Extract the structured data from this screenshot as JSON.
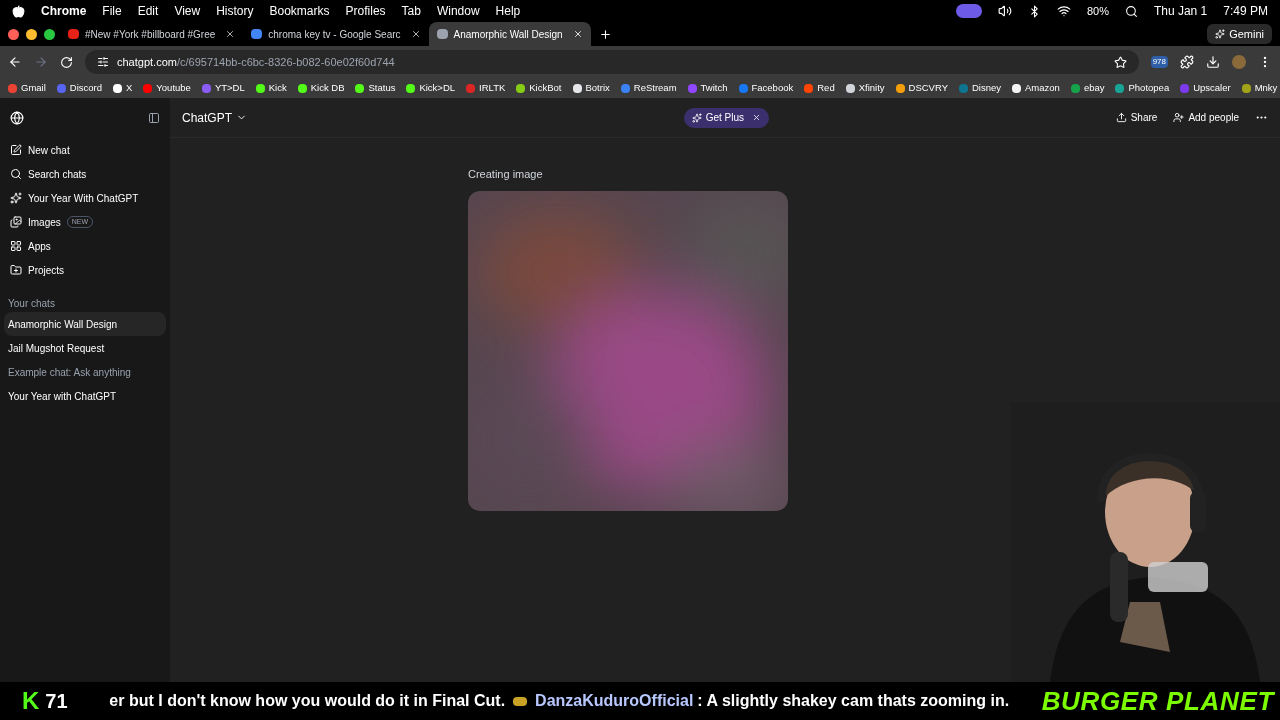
{
  "menu_bar": {
    "app": "Chrome",
    "menus": [
      "File",
      "Edit",
      "View",
      "History",
      "Bookmarks",
      "Profiles",
      "Tab",
      "Window",
      "Help"
    ],
    "battery": "80%",
    "date": "Thu Jan 1",
    "time": "7:49 PM"
  },
  "tabs": [
    {
      "title": "#New #York #billboard #Gree",
      "selected": false,
      "color": "#e62117"
    },
    {
      "title": "chroma key tv - Google Searc",
      "selected": false,
      "color": "#4285f4"
    },
    {
      "title": "Anamorphic Wall Design",
      "selected": true,
      "color": "#9ca3af"
    }
  ],
  "gemini": "Gemini",
  "address": {
    "host": "chatgpt.com",
    "path": "/c/695714bb-c6bc-8326-b082-60e02f60d744"
  },
  "extension_badge": "978",
  "bookmarks": [
    {
      "label": "Gmail",
      "color": "#ea4335"
    },
    {
      "label": "Discord",
      "color": "#5865f2"
    },
    {
      "label": "X",
      "color": "#ffffff"
    },
    {
      "label": "Youtube",
      "color": "#ff0000"
    },
    {
      "label": "YT>DL",
      "color": "#8b5cf6"
    },
    {
      "label": "Kick",
      "color": "#53fc18"
    },
    {
      "label": "Kick DB",
      "color": "#53fc18"
    },
    {
      "label": "Status",
      "color": "#53fc18"
    },
    {
      "label": "Kick>DL",
      "color": "#53fc18"
    },
    {
      "label": "IRLTK",
      "color": "#dc2626"
    },
    {
      "label": "KickBot",
      "color": "#84cc16"
    },
    {
      "label": "Botrix",
      "color": "#e5e7eb"
    },
    {
      "label": "ReStream",
      "color": "#3b82f6"
    },
    {
      "label": "Twitch",
      "color": "#9146ff"
    },
    {
      "label": "Facebook",
      "color": "#1877f2"
    },
    {
      "label": "Red",
      "color": "#ff4500"
    },
    {
      "label": "Xfinity",
      "color": "#d1d5db"
    },
    {
      "label": "DSCVRY",
      "color": "#f59e0b"
    },
    {
      "label": "Disney",
      "color": "#0e7490"
    },
    {
      "label": "Amazon",
      "color": "#f3f4f6"
    },
    {
      "label": "ebay",
      "color": "#16a34a"
    },
    {
      "label": "Photopea",
      "color": "#18a497"
    },
    {
      "label": "Upscaler",
      "color": "#7c3aed"
    },
    {
      "label": "Mnky",
      "color": "#a3a31a"
    }
  ],
  "sidebar": {
    "items": [
      {
        "label": "New chat",
        "kind": "edit"
      },
      {
        "label": "Search chats",
        "kind": "search"
      },
      {
        "label": "Your Year With ChatGPT",
        "kind": "sparkle"
      },
      {
        "label": "Images",
        "kind": "images",
        "badge": "NEW"
      },
      {
        "label": "Apps",
        "kind": "apps"
      },
      {
        "label": "Projects",
        "kind": "folder"
      }
    ],
    "section": "Your chats",
    "chats": [
      {
        "title": "Anamorphic Wall Design",
        "selected": true,
        "muted": false
      },
      {
        "title": "Jail Mugshot Request",
        "selected": false,
        "muted": false
      },
      {
        "title": "Example chat: Ask anything",
        "selected": false,
        "muted": true
      },
      {
        "title": "Your Year with ChatGPT",
        "selected": false,
        "muted": false
      }
    ]
  },
  "header": {
    "model": "ChatGPT",
    "promo": "Get Plus",
    "share": "Share",
    "add_people": "Add people"
  },
  "conversation": {
    "status": "Creating image"
  },
  "overlay": {
    "logo": "K",
    "count": "71",
    "ticker_start": "er but I don't know how you would do it in Final Cut.",
    "username": "DanzaKuduroOfficial",
    "message": ": A slightly shakey cam thats zooming in.",
    "brand": "BURGER PLANET"
  }
}
